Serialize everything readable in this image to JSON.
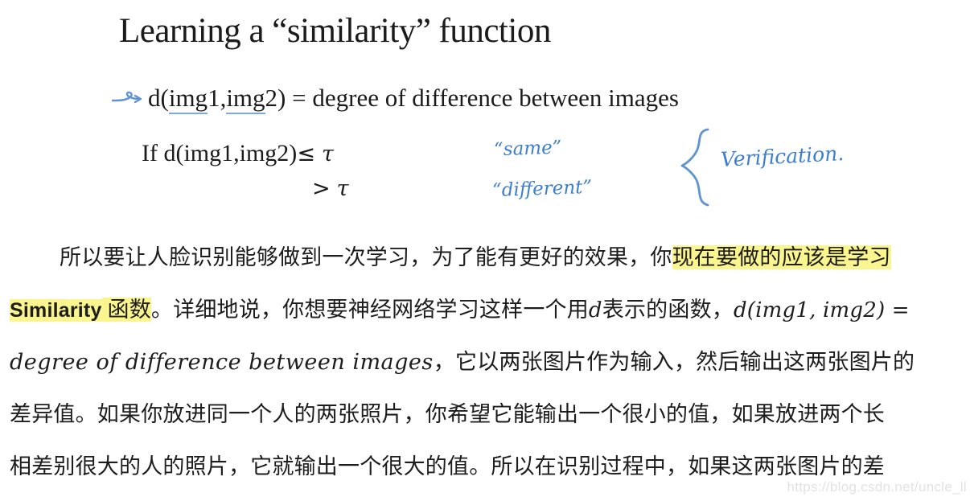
{
  "slide": {
    "title": "Learning a “similarity” function",
    "arrow_icon": "hand-drawn-arrow-icon",
    "definition": {
      "prefix": "d(",
      "img1_underlined": "img",
      "img1_rest": "1,",
      "img2_underlined": "img",
      "img2_rest": "2)",
      "equals_rhs": " = degree of difference between images",
      "full_text": "d(img1,img2) = degree of difference between images"
    },
    "condition": {
      "line1_prefix": "If d(img1,img2)",
      "line1_operator": "≤",
      "line1_threshold": "τ",
      "line2_operator": ">",
      "line2_threshold": "τ"
    },
    "annotations": {
      "same": "“same”",
      "different": "“different”",
      "verification": "Verification.",
      "brace_icon": "curly-brace-icon",
      "ink_color": "#3c7fd0"
    }
  },
  "body": {
    "lines": [
      {
        "segments": [
          {
            "text": "所以要让人脸识别能够做到一次学习，为了能有更好的效果，你",
            "style": "plain"
          },
          {
            "text": "现在要做的应该是学习",
            "style": "highlight"
          }
        ]
      },
      {
        "segments": [
          {
            "text": "Similarity",
            "style": "highlight-bold-sans"
          },
          {
            "text": " 函数",
            "style": "highlight"
          },
          {
            "text": "。详细地说，你想要神经网络学习这样一个用",
            "style": "plain"
          },
          {
            "text": "d",
            "style": "math-italic"
          },
          {
            "text": "表示的函数，",
            "style": "plain"
          },
          {
            "text": "d(img1, img2) =",
            "style": "math-italic"
          }
        ]
      },
      {
        "segments": [
          {
            "text": "degree of difference between images",
            "style": "math-italic-big"
          },
          {
            "text": "，它以两张图片作为输入，然后输出这两张图片的",
            "style": "plain"
          }
        ]
      },
      {
        "segments": [
          {
            "text": "差异值。如果你放进同一个人的两张照片，你希望它能输出一个很小的值，如果放进两个长",
            "style": "plain"
          }
        ]
      },
      {
        "segments": [
          {
            "text": "相差别很大的人的照片，它就输出一个很大的值。所以在识别过程中，如果这两张图片的差",
            "style": "plain"
          }
        ]
      }
    ]
  },
  "watermark": {
    "text": "https://blog.csdn.net/uncle_ll"
  },
  "colors": {
    "highlight_yellow": "#faf58e",
    "ink_blue": "#3c7fd0",
    "text_black": "#1d1d1d",
    "watermark_gray": "#e2e2e2"
  }
}
